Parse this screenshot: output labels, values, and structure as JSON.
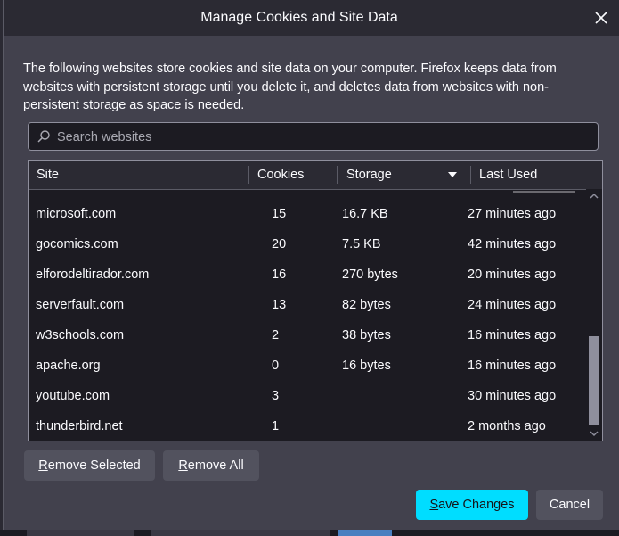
{
  "dialog": {
    "title": "Manage Cookies and Site Data",
    "description": "The following websites store cookies and site data on your computer. Firefox keeps data from websites with persistent storage until you delete it, and deletes data from websites with non-persistent storage as space is needed."
  },
  "search": {
    "placeholder": "Search websites",
    "value": ""
  },
  "table": {
    "columns": [
      "Site",
      "Cookies",
      "Storage",
      "Last Used"
    ],
    "sort_column": "Storage",
    "rows": [
      {
        "site": "microsoft.com",
        "cookies": "15",
        "storage": "16.7 KB",
        "last_used": "27 minutes ago"
      },
      {
        "site": "gocomics.com",
        "cookies": "20",
        "storage": "7.5 KB",
        "last_used": "42 minutes ago"
      },
      {
        "site": "elforodeltirador.com",
        "cookies": "16",
        "storage": "270 bytes",
        "last_used": "20 minutes ago"
      },
      {
        "site": "serverfault.com",
        "cookies": "13",
        "storage": "82 bytes",
        "last_used": "24 minutes ago"
      },
      {
        "site": "w3schools.com",
        "cookies": "2",
        "storage": "38 bytes",
        "last_used": "16 minutes ago"
      },
      {
        "site": "apache.org",
        "cookies": "0",
        "storage": "16 bytes",
        "last_used": "16 minutes ago"
      },
      {
        "site": "youtube.com",
        "cookies": "3",
        "storage": "",
        "last_used": "30 minutes ago"
      },
      {
        "site": "thunderbird.net",
        "cookies": "1",
        "storage": "",
        "last_used": "2 months ago"
      }
    ]
  },
  "buttons": {
    "remove_selected_first": "R",
    "remove_selected_rest": "emove Selected",
    "remove_all_first": "R",
    "remove_all_rest": "emove All",
    "save_first": "S",
    "save_rest": "ave Changes",
    "cancel": "Cancel"
  },
  "colors": {
    "dialog_bg": "#42414d",
    "titlebar_bg": "#2b2a33",
    "list_bg": "#1c1b22",
    "primary_button": "#00ddff",
    "secondary_button": "#52525e"
  },
  "icons": {
    "close": "close-icon",
    "search": "search-icon",
    "sort": "sort-descending-icon",
    "scroll_up": "scroll-up-arrow-icon",
    "scroll_down": "scroll-down-arrow-icon"
  }
}
